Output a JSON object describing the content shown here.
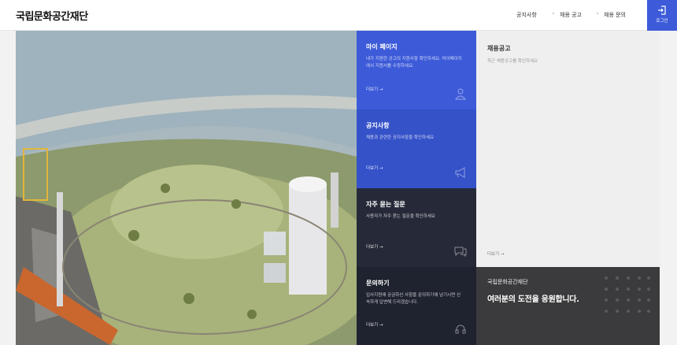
{
  "header": {
    "logo": "국립문화공간재단",
    "nav": [
      "공지사항",
      "채용 공고",
      "채용 문의"
    ],
    "login_label": "로그인"
  },
  "cards": [
    {
      "title": "마이 페이지",
      "desc": "내가 지원한 공고의 지원사항 확인하세요. 마이페이지에서 지원서를 수정하세요.",
      "more": "더보기  →",
      "icon": "user-icon",
      "color": "#3d5bd9"
    },
    {
      "title": "공지사항",
      "desc": "채용과 관련한 공지사항을 확인하세요",
      "more": "더보기  →",
      "icon": "megaphone-icon",
      "color": "#3552c9"
    },
    {
      "title": "자주 묻는 질문",
      "desc": "사용자가 자주 묻는 질문을 확인하세요",
      "more": "더보기  →",
      "icon": "chat-icon",
      "color": "#262a38"
    },
    {
      "title": "문의하기",
      "desc": "입사지원에 궁금하신 사항을 문의하기에 남기시면 신속하게 답변해 드리겠습니다.",
      "more": "더보기  →",
      "icon": "headset-icon",
      "color": "#1f2330"
    }
  ],
  "recruit": {
    "title": "채용공고",
    "desc": "최근 채용공고를 확인하세요",
    "more": "더보기  →"
  },
  "cheer": {
    "org": "국립문화공간재단",
    "slogan": "여러분의 도전을 응원합니다."
  }
}
